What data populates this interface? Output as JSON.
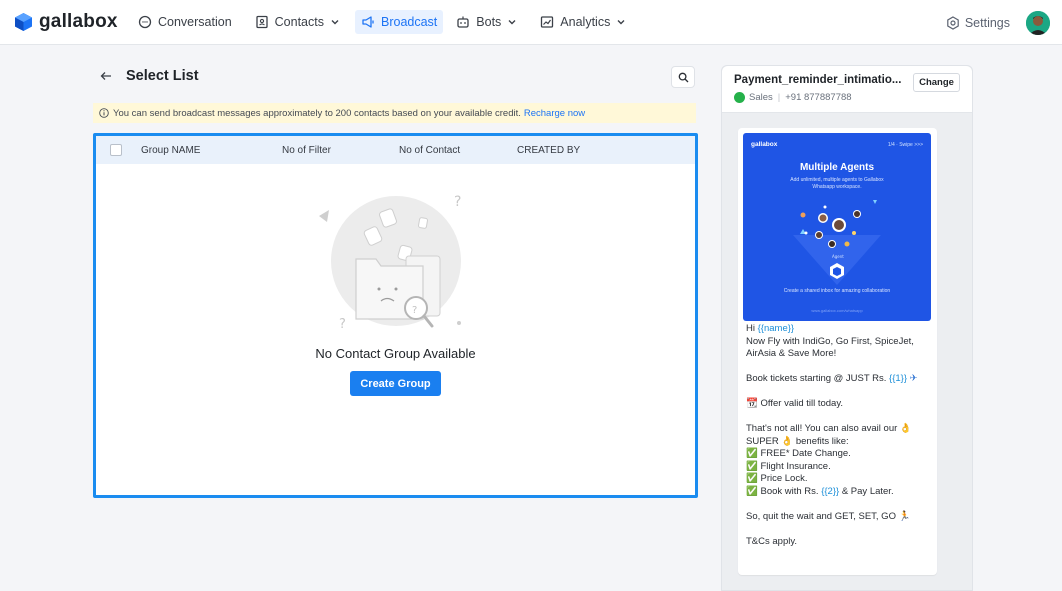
{
  "nav": {
    "brand": "gallabox",
    "items": [
      {
        "label": "Conversation",
        "icon": "chat-icon",
        "dropdown": false,
        "active": false
      },
      {
        "label": "Contacts",
        "icon": "contacts-icon",
        "dropdown": true,
        "active": false
      },
      {
        "label": "Broadcast",
        "icon": "megaphone-icon",
        "dropdown": false,
        "active": true
      },
      {
        "label": "Bots",
        "icon": "bot-icon",
        "dropdown": true,
        "active": false
      },
      {
        "label": "Analytics",
        "icon": "chart-icon",
        "dropdown": true,
        "active": false
      }
    ],
    "settings_label": "Settings",
    "accent": "#1d74f5"
  },
  "page": {
    "title": "Select List",
    "notice_text": "You can send broadcast messages approximately to 200 contacts based on your available credit.",
    "notice_link": "Recharge now"
  },
  "table": {
    "columns": [
      "Group NAME",
      "No of Filter",
      "No of Contact",
      "CREATED BY"
    ],
    "rows": [],
    "empty_text": "No Contact Group Available",
    "create_label": "Create Group"
  },
  "template": {
    "name": "Payment_reminder_intimatio...",
    "channel": "Sales",
    "phone": "+91 877887788",
    "change_label": "Change",
    "media": {
      "logo": "gallabox",
      "corner": "1/4 · Swipe >>>",
      "title": "Multiple Agents",
      "subtitle": "Add unlimited, multiple agents to Gallabox Whatsapp workspace.",
      "agent_label": "Agent",
      "caption": "Create a shared inbox for amazing collaboration",
      "url": "www.gallabox.com/whatsapp"
    },
    "message": {
      "greeting": "Hi",
      "var_name": "{{name}}",
      "line1": "Now Fly with IndiGo, Go First, SpiceJet, AirAsia & Save More!",
      "line2": "Book tickets starting @ JUST Rs.",
      "var1": "{{1}}",
      "line3": "Offer valid till today.",
      "line4": "That's not all! You can also avail our",
      "line4b": "SUPER",
      "line4c": "benefits like:",
      "benefits": [
        "FREE* Date Change.",
        "Flight Insurance.",
        "Price Lock."
      ],
      "benefit4_pre": "Book with Rs.",
      "var2": "{{2}}",
      "benefit4_post": "& Pay Later.",
      "line5": "So, quit the wait and GET, SET, GO",
      "line6": "T&Cs apply."
    }
  }
}
